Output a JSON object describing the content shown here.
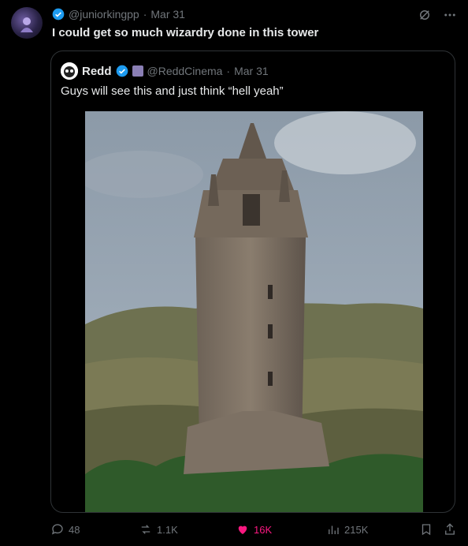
{
  "tweet": {
    "handle": "@juniorkingpp",
    "separator": "·",
    "date": "Mar 31",
    "text": "I could get so much wizardry done in this tower"
  },
  "quoted": {
    "name": "Redd",
    "handle": "@ReddCinema",
    "separator": "·",
    "date": "Mar 31",
    "text": "Guys will see this and just think “hell yeah”",
    "image_description_icon": "tower-photo"
  },
  "actions": {
    "replies": "48",
    "reposts": "1.1K",
    "likes": "16K",
    "views": "215K"
  },
  "colors": {
    "verified": "#1d9bf0",
    "like": "#f91880",
    "muted": "#71767b",
    "border": "#2f3336"
  }
}
